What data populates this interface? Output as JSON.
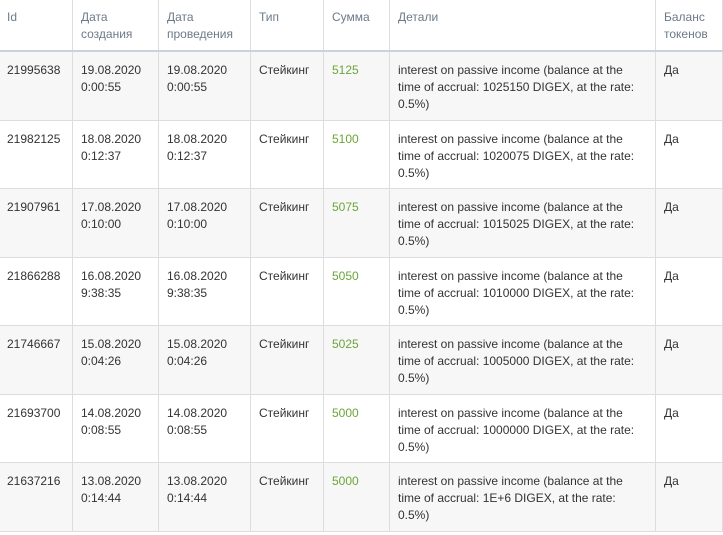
{
  "table": {
    "headers": {
      "id": "Id",
      "created": [
        "Дата",
        "создания"
      ],
      "posted": [
        "Дата",
        "проведения"
      ],
      "type": "Тип",
      "amount": "Сумма",
      "details": "Детали",
      "balance": [
        "Баланс",
        "токенов"
      ]
    },
    "rows": [
      {
        "id": "21995638",
        "created_date": "19.08.2020",
        "created_time": "0:00:55",
        "posted_date": "19.08.2020",
        "posted_time": "0:00:55",
        "type": "Стейкинг",
        "amount": "5125",
        "details": "interest on passive income (balance at the time of accrual: 1025150 DIGEX, at the rate: 0.5%)",
        "balance": "Да"
      },
      {
        "id": "21982125",
        "created_date": "18.08.2020",
        "created_time": "0:12:37",
        "posted_date": "18.08.2020",
        "posted_time": "0:12:37",
        "type": "Стейкинг",
        "amount": "5100",
        "details": "interest on passive income (balance at the time of accrual: 1020075 DIGEX, at the rate: 0.5%)",
        "balance": "Да"
      },
      {
        "id": "21907961",
        "created_date": "17.08.2020",
        "created_time": "0:10:00",
        "posted_date": "17.08.2020",
        "posted_time": "0:10:00",
        "type": "Стейкинг",
        "amount": "5075",
        "details": "interest on passive income (balance at the time of accrual: 1015025 DIGEX, at the rate: 0.5%)",
        "balance": "Да"
      },
      {
        "id": "21866288",
        "created_date": "16.08.2020",
        "created_time": "9:38:35",
        "posted_date": "16.08.2020",
        "posted_time": "9:38:35",
        "type": "Стейкинг",
        "amount": "5050",
        "details": "interest on passive income (balance at the time of accrual: 1010000 DIGEX, at the rate: 0.5%)",
        "balance": "Да"
      },
      {
        "id": "21746667",
        "created_date": "15.08.2020",
        "created_time": "0:04:26",
        "posted_date": "15.08.2020",
        "posted_time": "0:04:26",
        "type": "Стейкинг",
        "amount": "5025",
        "details": "interest on passive income (balance at the time of accrual: 1005000 DIGEX, at the rate: 0.5%)",
        "balance": "Да"
      },
      {
        "id": "21693700",
        "created_date": "14.08.2020",
        "created_time": "0:08:55",
        "posted_date": "14.08.2020",
        "posted_time": "0:08:55",
        "type": "Стейкинг",
        "amount": "5000",
        "details": "interest on passive income (balance at the time of accrual: 1000000 DIGEX, at the rate: 0.5%)",
        "balance": "Да"
      },
      {
        "id": "21637216",
        "created_date": "13.08.2020",
        "created_time": "0:14:44",
        "posted_date": "13.08.2020",
        "posted_time": "0:14:44",
        "type": "Стейкинг",
        "amount": "5000",
        "details": "interest on passive income (balance at the time of accrual: 1E+6 DIGEX, at the rate: 0.5%)",
        "balance": "Да"
      }
    ]
  },
  "colors": {
    "amount": "#6ba53a",
    "header_text": "#6d7a88",
    "header_border": "#c8d3e0",
    "row_alt": "#f7f7f7"
  }
}
